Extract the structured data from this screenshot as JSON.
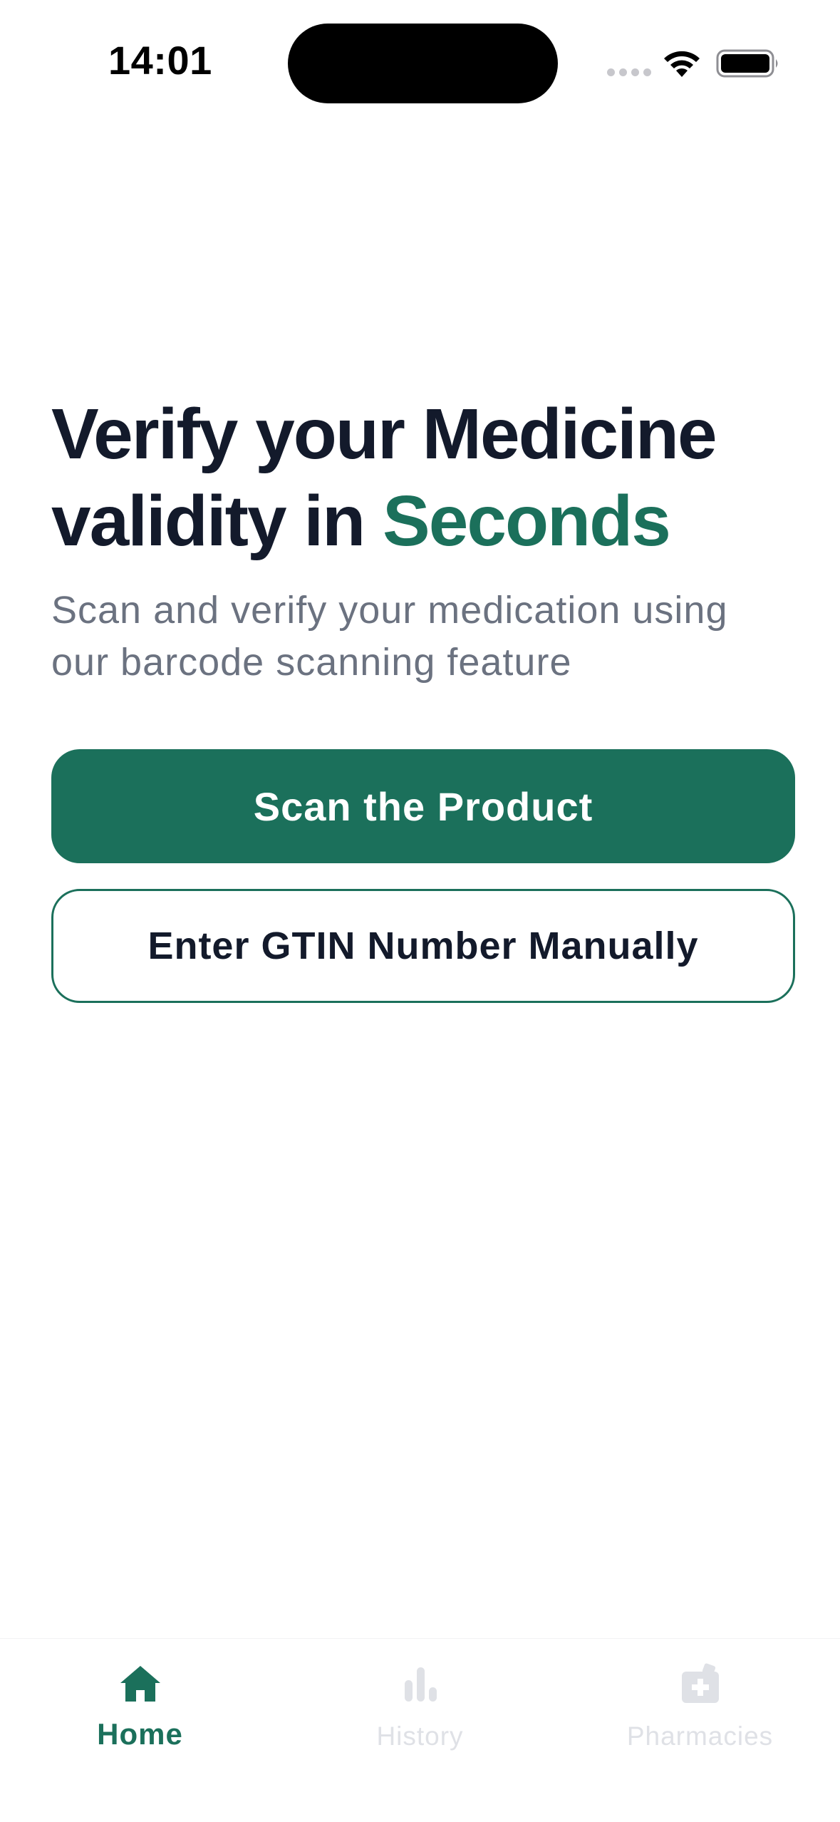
{
  "status_bar": {
    "time": "14:01"
  },
  "hero": {
    "title_line1": "Verify your Medicine",
    "title_line2_prefix": "validity in ",
    "title_line2_accent": "Seconds",
    "subtitle": "Scan and verify your medication using our barcode scanning feature"
  },
  "actions": {
    "scan_label": "Scan the Product",
    "manual_label": "Enter GTIN Number Manually"
  },
  "tab_bar": {
    "items": [
      {
        "label": "Home",
        "icon": "home-icon",
        "active": true
      },
      {
        "label": "History",
        "icon": "bar-chart-icon",
        "active": false
      },
      {
        "label": "Pharmacies",
        "icon": "pharmacy-icon",
        "active": false
      }
    ]
  },
  "colors": {
    "brand": "#1b705b",
    "heading": "#131a2b",
    "subtitle": "#6b7280",
    "inactive_tab": "#dfe1e6"
  }
}
